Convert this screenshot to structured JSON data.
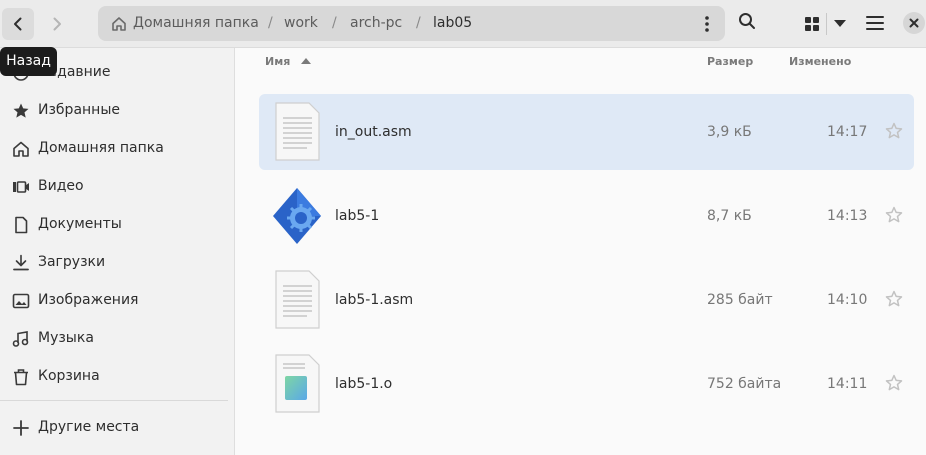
{
  "header": {
    "back_icon": "chevron-left-icon",
    "forward_icon": "chevron-right-icon",
    "breadcrumbs": [
      {
        "label": "Домашняя папка",
        "icon": "home-icon"
      },
      {
        "label": "work"
      },
      {
        "label": "arch-pc"
      },
      {
        "label": "lab05"
      }
    ],
    "separator": "/",
    "search_icon": "search-icon",
    "view_icon": "grid-view-icon",
    "menu_icon": "hamburger-menu-icon",
    "close_icon": "close-icon"
  },
  "tooltip": {
    "text": "Назад"
  },
  "sidebar": {
    "items": [
      {
        "label": "Недавние",
        "icon": "clock-icon"
      },
      {
        "label": "Избранные",
        "icon": "star-icon"
      },
      {
        "label": "Домашняя папка",
        "icon": "home-icon"
      },
      {
        "label": "Видео",
        "icon": "video-icon"
      },
      {
        "label": "Документы",
        "icon": "document-icon"
      },
      {
        "label": "Загрузки",
        "icon": "download-icon"
      },
      {
        "label": "Изображения",
        "icon": "image-icon"
      },
      {
        "label": "Музыка",
        "icon": "music-icon"
      },
      {
        "label": "Корзина",
        "icon": "trash-icon"
      }
    ],
    "other": {
      "label": "Другие места",
      "icon": "plus-icon"
    }
  },
  "columns": {
    "name": "Имя",
    "size": "Размер",
    "modified": "Изменено"
  },
  "files": [
    {
      "name": "in_out.asm",
      "size": "3,9 кБ",
      "modified": "14:17",
      "icon": "text-file-icon",
      "selected": true
    },
    {
      "name": "lab5-1",
      "size": "8,7 кБ",
      "modified": "14:13",
      "icon": "executable-icon",
      "selected": false
    },
    {
      "name": "lab5-1.asm",
      "size": "285 байт",
      "modified": "14:10",
      "icon": "text-file-icon",
      "selected": false
    },
    {
      "name": "lab5-1.o",
      "size": "752 байта",
      "modified": "14:11",
      "icon": "object-file-icon",
      "selected": false
    }
  ],
  "colors": {
    "accent": "#3584e4",
    "selection": "#dfe9f6"
  }
}
